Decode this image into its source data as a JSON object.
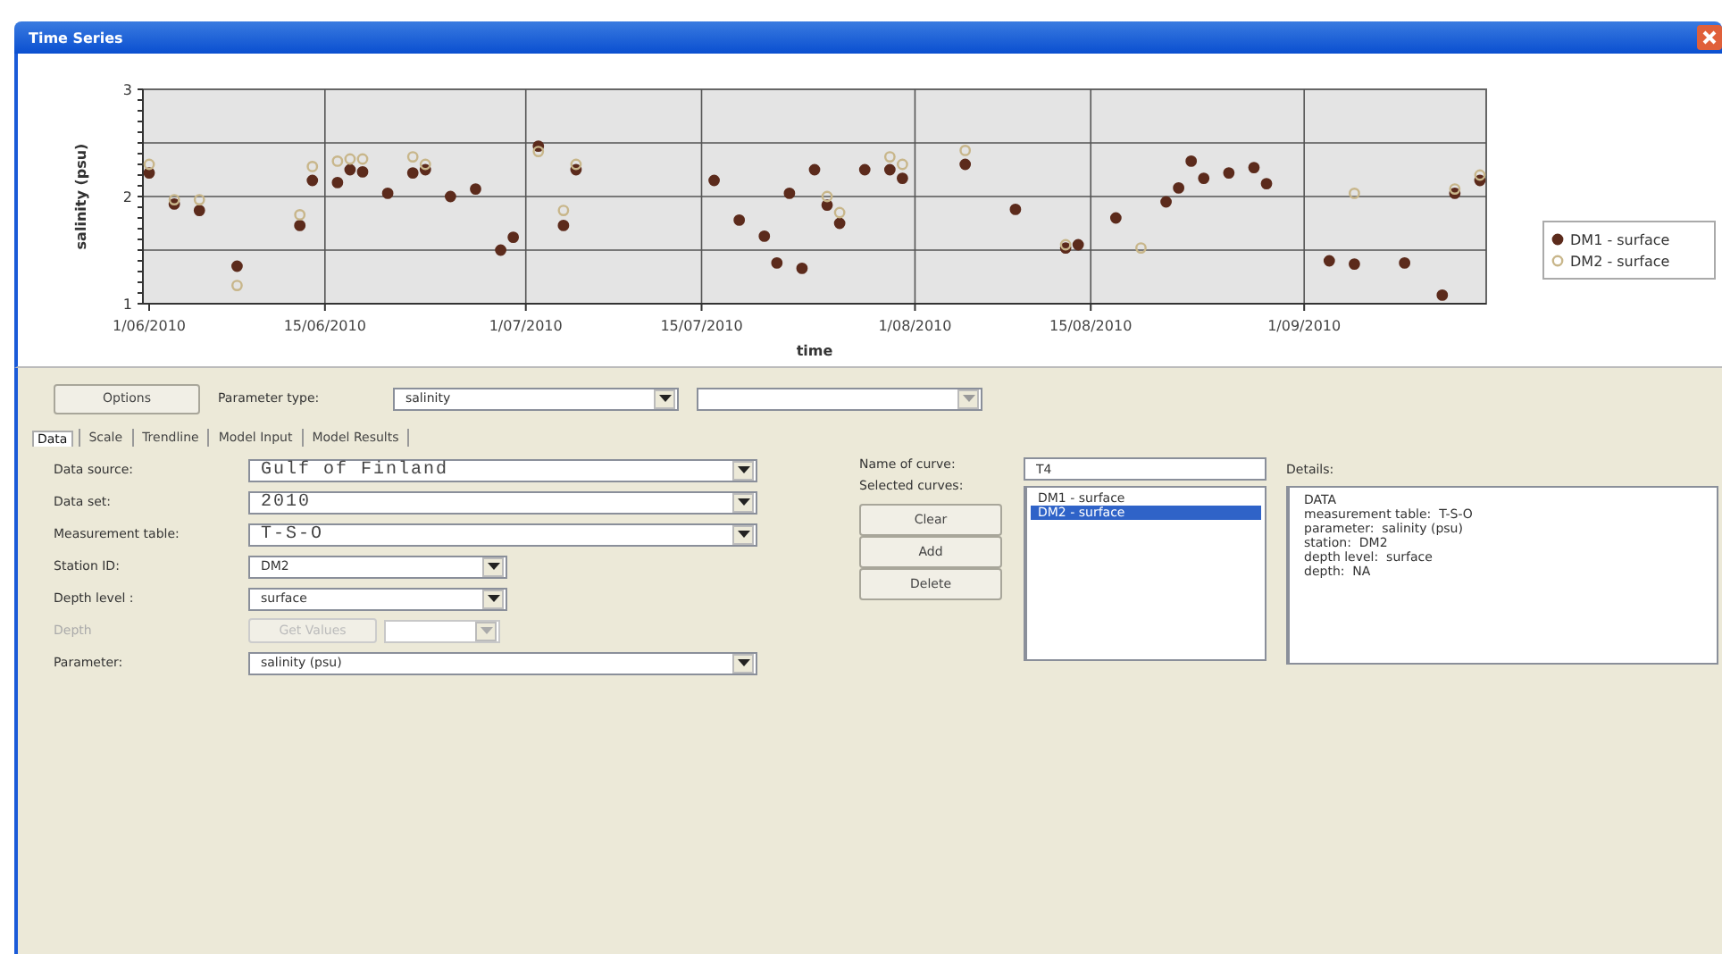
{
  "window": {
    "title": "Time Series"
  },
  "chart": {
    "chart_data": {
      "type": "scatter",
      "xlabel": "time",
      "ylabel": "salinity (psu)",
      "ylim": [
        1,
        3
      ],
      "yticks": [
        1,
        2,
        3
      ],
      "grid": true,
      "legend": true,
      "categories": [
        "1/06/2010",
        null,
        null,
        null,
        null,
        null,
        null,
        null,
        null,
        null,
        null,
        null,
        null,
        null,
        "15/06/2010",
        null,
        null,
        null,
        null,
        null,
        null,
        null,
        null,
        null,
        null,
        null,
        null,
        null,
        null,
        null,
        "1/07/2010",
        null,
        null,
        null,
        null,
        null,
        null,
        null,
        null,
        null,
        null,
        null,
        null,
        null,
        "15/07/2010",
        null,
        null,
        null,
        null,
        null,
        null,
        null,
        null,
        null,
        null,
        null,
        null,
        null,
        null,
        null,
        null,
        "1/08/2010",
        null,
        null,
        null,
        null,
        null,
        null,
        null,
        null,
        null,
        null,
        null,
        null,
        null,
        "15/08/2010",
        null,
        null,
        null,
        null,
        null,
        null,
        null,
        null,
        null,
        null,
        null,
        null,
        null,
        null,
        null,
        null,
        "1/09/2010",
        null,
        null,
        null,
        null,
        null,
        null,
        null,
        null,
        null,
        null,
        null,
        null,
        null,
        null
      ],
      "series": [
        {
          "name": "DM1 - surface",
          "color": "#5c2b1c",
          "values": [
            2.22,
            null,
            1.93,
            null,
            1.87,
            null,
            null,
            1.35,
            null,
            null,
            null,
            null,
            1.73,
            2.15,
            null,
            2.13,
            2.25,
            2.23,
            null,
            2.03,
            null,
            2.22,
            2.25,
            null,
            2.0,
            null,
            2.07,
            null,
            1.5,
            1.62,
            null,
            2.47,
            null,
            1.73,
            2.25,
            null,
            null,
            null,
            null,
            null,
            null,
            null,
            null,
            null,
            null,
            2.15,
            null,
            1.78,
            null,
            1.63,
            1.38,
            2.03,
            1.33,
            2.25,
            1.92,
            1.75,
            null,
            2.25,
            null,
            2.25,
            2.17,
            null,
            null,
            null,
            null,
            2.3,
            null,
            null,
            null,
            1.88,
            null,
            null,
            null,
            1.52,
            1.55,
            null,
            null,
            1.8,
            null,
            null,
            null,
            1.95,
            2.08,
            2.33,
            2.17,
            null,
            2.22,
            null,
            2.27,
            2.12,
            null,
            null,
            null,
            null,
            1.4,
            null,
            1.37,
            null,
            null,
            null,
            1.38,
            null,
            null,
            1.08,
            2.03,
            null,
            2.15
          ]
        },
        {
          "name": "DM2 - surface",
          "color": "#c8b68a",
          "values": [
            2.3,
            null,
            1.97,
            null,
            1.97,
            null,
            null,
            1.17,
            null,
            null,
            null,
            null,
            1.83,
            2.28,
            null,
            2.33,
            2.35,
            2.35,
            null,
            null,
            null,
            2.37,
            2.3,
            null,
            null,
            null,
            null,
            null,
            null,
            null,
            null,
            2.42,
            null,
            1.87,
            2.3,
            null,
            null,
            null,
            null,
            null,
            null,
            null,
            null,
            null,
            null,
            null,
            null,
            null,
            null,
            null,
            null,
            null,
            null,
            null,
            2.0,
            1.85,
            null,
            null,
            null,
            2.37,
            2.3,
            null,
            null,
            null,
            null,
            2.43,
            null,
            null,
            null,
            null,
            null,
            null,
            null,
            1.55,
            null,
            null,
            null,
            null,
            null,
            1.52,
            null,
            null,
            null,
            null,
            null,
            null,
            null,
            null,
            null,
            null,
            null,
            null,
            null,
            null,
            null,
            null,
            2.03,
            null,
            null,
            null,
            null,
            null,
            null,
            null,
            2.07,
            null,
            2.2
          ]
        }
      ]
    }
  },
  "toolbar": {
    "options_button": "Options",
    "parameter_type_label": "Parameter type:",
    "parameter_type_value": "salinity"
  },
  "tabs": [
    {
      "label": "Data",
      "selected": true
    },
    {
      "label": "Scale",
      "selected": false
    },
    {
      "label": "Trendline",
      "selected": false
    },
    {
      "label": "Model Input",
      "selected": false
    },
    {
      "label": "Model Results",
      "selected": false
    }
  ],
  "fields": [
    {
      "kind": "wide",
      "label": "Data source:",
      "value": "Gulf of Finland",
      "disabled": false
    },
    {
      "kind": "wide",
      "label": "Data set:",
      "value": "2010",
      "disabled": false
    },
    {
      "kind": "wide",
      "label": "Measurement table:",
      "value": "T-S-O",
      "disabled": false
    },
    {
      "kind": "narrow",
      "label": "Station ID:",
      "value": "DM2",
      "disabled": false
    },
    {
      "kind": "narrow",
      "label": "Depth level :",
      "value": "surface",
      "disabled": false
    },
    {
      "kind": "depth",
      "label": "Depth",
      "button": "Get Values",
      "disabled": true
    },
    {
      "kind": "wide",
      "label": "Parameter:",
      "value": "salinity (psu)",
      "disabled": false
    }
  ],
  "curves": {
    "name_label": "Name of curve:",
    "name_value": "T4",
    "selected_label": "Selected curves:",
    "items": [
      {
        "label": "DM1 - surface",
        "selected": false
      },
      {
        "label": "DM2 - surface",
        "selected": true
      }
    ],
    "buttons": [
      "Clear",
      "Add",
      "Delete"
    ],
    "details_label": "Details:",
    "details": [
      "DATA",
      "measurement table:  T-S-O",
      "parameter:  salinity (psu)",
      "station:  DM2",
      "depth level:  surface",
      "depth:  NA"
    ]
  }
}
